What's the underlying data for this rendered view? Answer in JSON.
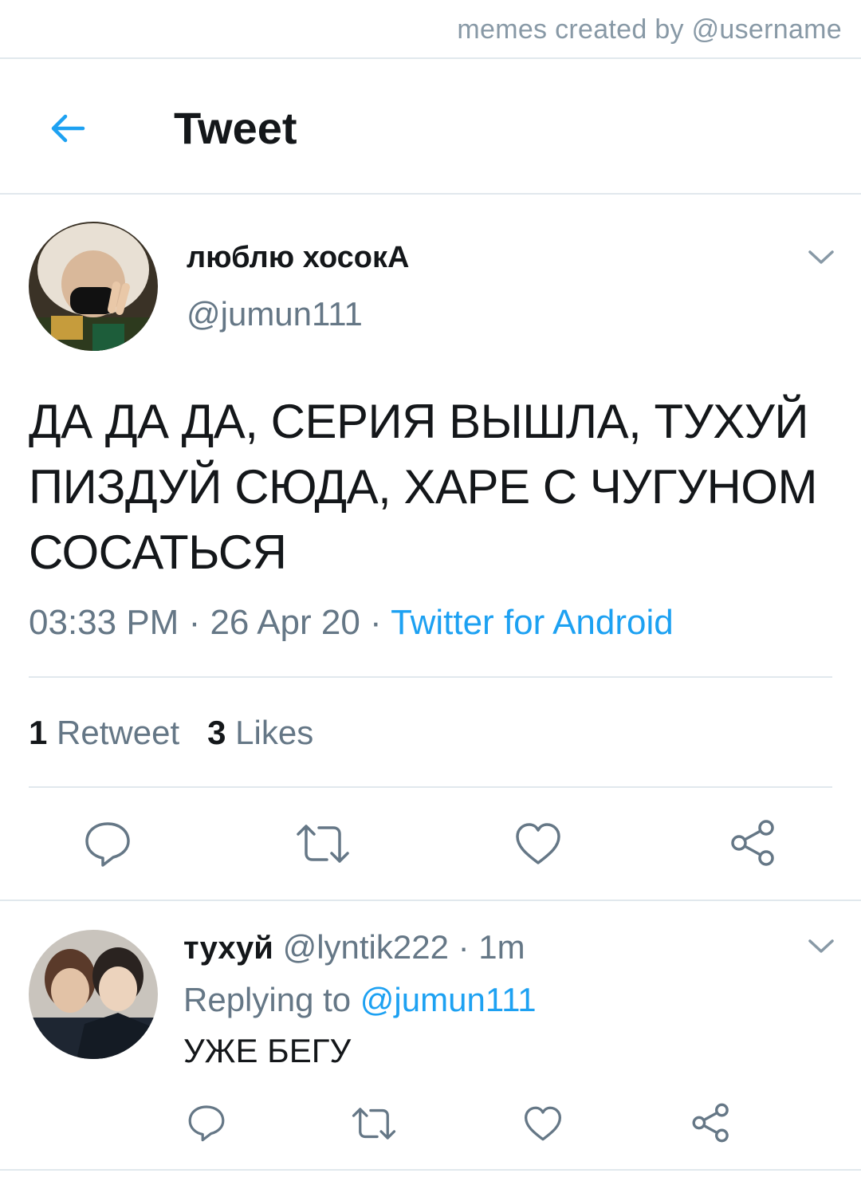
{
  "watermark": "memes created by @username",
  "header": {
    "title": "Tweet",
    "back_icon": "arrow-left-icon"
  },
  "colors": {
    "accent": "#1da1f2",
    "secondary_text": "#657786",
    "primary_text": "#14171a",
    "divider": "#e1e8ed"
  },
  "tweet": {
    "display_name": "люблю хосокА",
    "handle": "@jumun111",
    "text": "ДА ДА ДА, СЕРИЯ ВЫШЛА, ТУХУЙ ПИЗДУЙ СЮДА, ХАРЕ С ЧУГУНОМ СОСАТЬСЯ",
    "time": "03:33 PM",
    "date": "26 Apr 20",
    "separator": " · ",
    "source": "Twitter for Android",
    "retweets_count": "1",
    "retweets_label": "Retweet",
    "likes_count": "3",
    "likes_label": "Likes"
  },
  "reply": {
    "display_name": "тухуй",
    "handle": "@lyntik222",
    "age": "1m",
    "replying_prefix": "Replying to ",
    "replying_to": "@jumun111",
    "text": "УЖЕ БЕГУ"
  },
  "icons": [
    "reply-icon",
    "retweet-icon",
    "like-icon",
    "share-icon",
    "chevron-down-icon"
  ]
}
